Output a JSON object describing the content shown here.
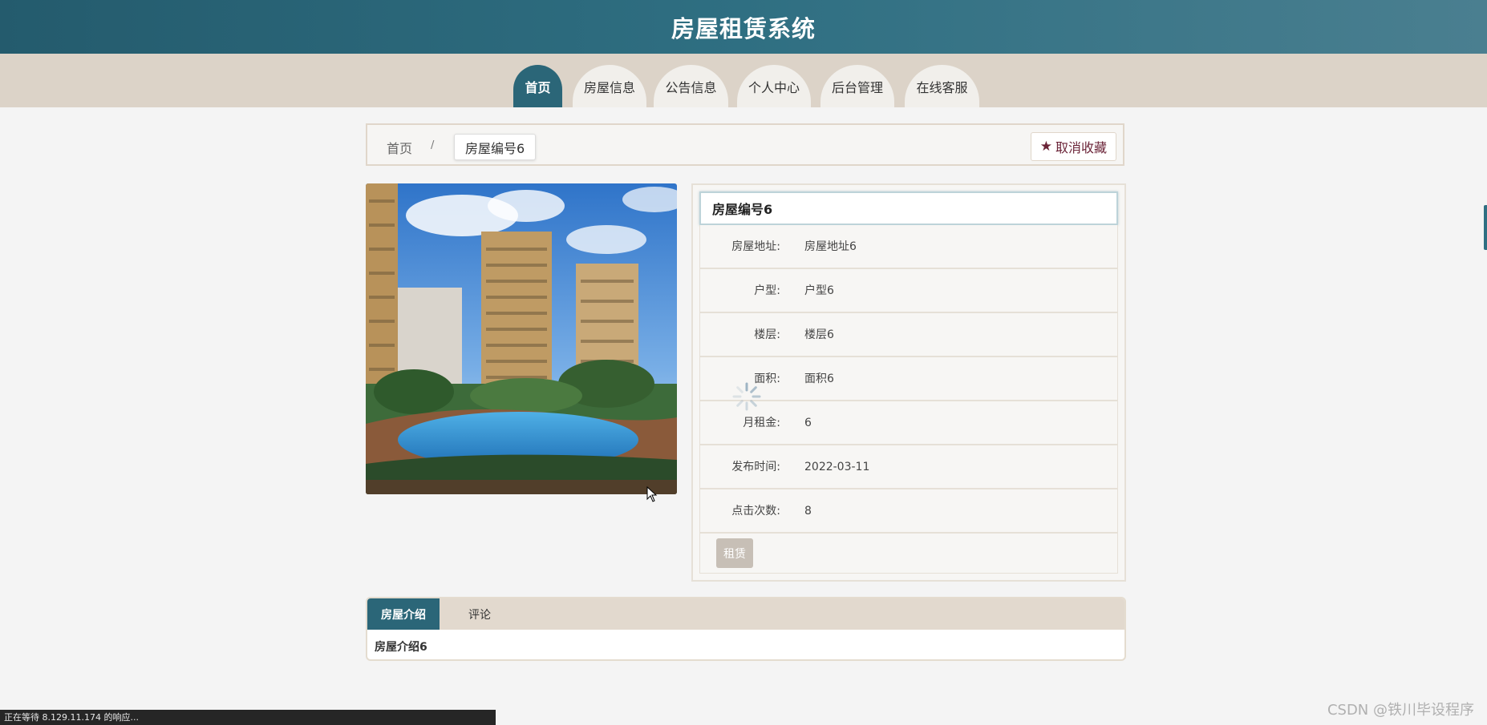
{
  "header": {
    "title": "房屋租赁系统"
  },
  "nav": {
    "items": [
      {
        "label": "首页",
        "active": true
      },
      {
        "label": "房屋信息",
        "active": false
      },
      {
        "label": "公告信息",
        "active": false
      },
      {
        "label": "个人中心",
        "active": false
      },
      {
        "label": "后台管理",
        "active": false
      },
      {
        "label": "在线客服",
        "active": false
      }
    ]
  },
  "breadcrumb": {
    "home": "首页",
    "separator": "/",
    "current": "房屋编号6",
    "favorite_label": "取消收藏",
    "favorite_icon": "star-icon"
  },
  "detail": {
    "title": "房屋编号6",
    "rows": [
      {
        "label": "房屋地址:",
        "value": "房屋地址6"
      },
      {
        "label": "户型:",
        "value": "户型6"
      },
      {
        "label": "楼层:",
        "value": "楼层6"
      },
      {
        "label": "面积:",
        "value": "面积6"
      },
      {
        "label": "月租金:",
        "value": "6"
      },
      {
        "label": "发布时间:",
        "value": "2022-03-11"
      },
      {
        "label": "点击次数:",
        "value": "8"
      }
    ],
    "rent_label": "租赁"
  },
  "tabs": {
    "items": [
      {
        "label": "房屋介绍",
        "active": true
      },
      {
        "label": "评论",
        "active": false
      }
    ],
    "content": "房屋介绍6"
  },
  "status": {
    "text": "正在等待 8.129.11.174 的响应..."
  },
  "watermark": "CSDN @铁川毕设程序",
  "colors": {
    "header": "#2b6678",
    "nav_bg": "#dcd3c8",
    "accent": "#2b6678",
    "favorite_text": "#6b2438"
  }
}
